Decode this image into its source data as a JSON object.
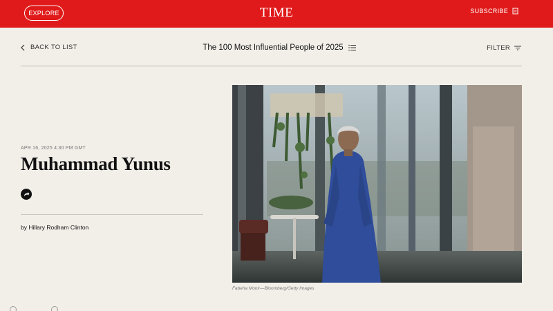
{
  "header": {
    "explore_label": "EXPLORE",
    "logo_text": "TIME",
    "subscribe_label": "SUBSCRIBE",
    "bar_color": "#e01a1a"
  },
  "nav": {
    "back_label": "BACK TO LIST",
    "list_title": "The 100 Most Influential People of 2025",
    "filter_label": "FILTER"
  },
  "article": {
    "date": "APR 16, 2025 4:30 PM GMT",
    "title": "Muhammad Yunus",
    "byline_prefix": "by",
    "author": "Hillary Rodham Clinton"
  },
  "image": {
    "credit": "Fabeha Monir—Bloomberg/Getty Images"
  },
  "icons": [
    "chevron-left-icon",
    "list-icon",
    "filter-icon",
    "subscribe-icon",
    "share-icon"
  ]
}
